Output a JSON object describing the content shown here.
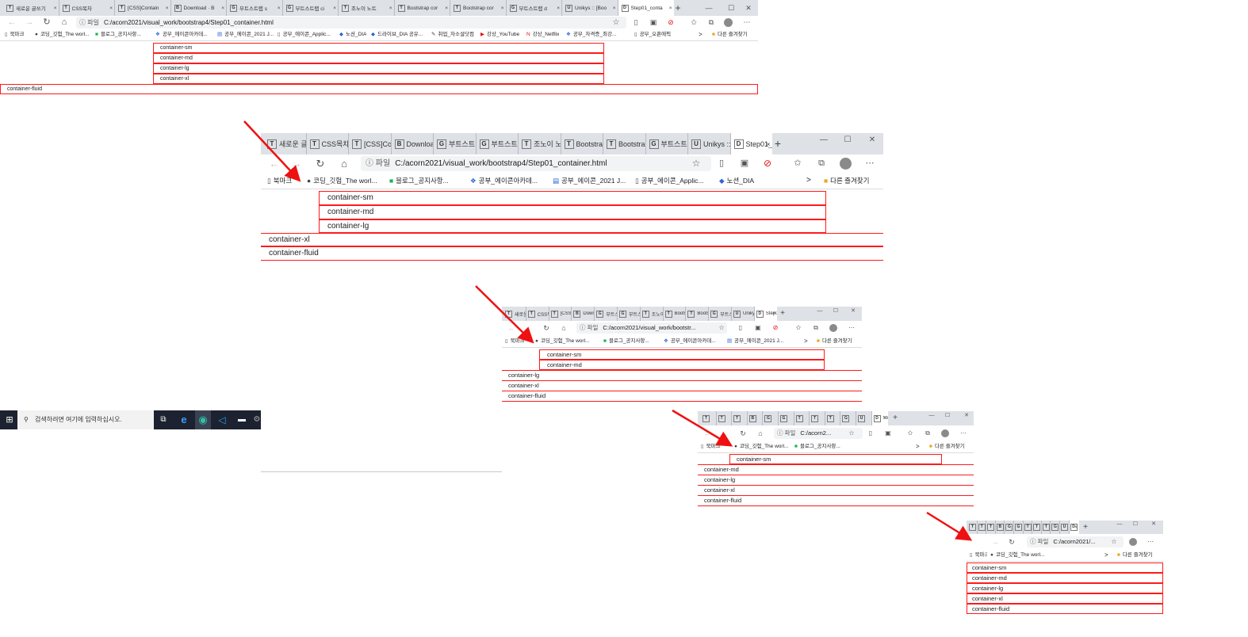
{
  "window": {
    "tabs": [
      {
        "icon": "T",
        "label": "새로운 글쓰기"
      },
      {
        "icon": "T",
        "label": "CSS목차"
      },
      {
        "icon": "T",
        "label": "[CSS]Contain"
      },
      {
        "icon": "B",
        "label": "Download · B"
      },
      {
        "icon": "G",
        "label": "부트스트랩 s"
      },
      {
        "icon": "G",
        "label": "부트스트랩 ci"
      },
      {
        "icon": "T",
        "label": "조노이 노트"
      },
      {
        "icon": "T",
        "label": "Bootstrap cor"
      },
      {
        "icon": "T",
        "label": "Bootstrap cor"
      },
      {
        "icon": "G",
        "label": "부트스트랩 d"
      },
      {
        "icon": "U",
        "label": "Unikys :: [Boo"
      },
      {
        "icon": "D",
        "label": "Step01_conta"
      }
    ],
    "active_tab_index": 11,
    "new_tab_symbol": "+",
    "close_symbol": "×",
    "win_controls": [
      "—",
      "☐",
      "✕"
    ]
  },
  "address": {
    "scheme": "파일",
    "url": "C:/acorn2021/visual_work/bootstrap4/Step01_container.html",
    "url_short_3": "C:/acorn2021/visual_work/bootstr...",
    "url_short_4": "C:/acorn2...",
    "url_short_5": "C:/acorn2021/..."
  },
  "bookmarks": {
    "items": [
      {
        "icon": "doc-icon",
        "label": "북마크"
      },
      {
        "icon": "github-icon",
        "label": "코딩_깃험_The worl..."
      },
      {
        "icon": "chat-icon",
        "label": "블로그_공지사항..."
      },
      {
        "icon": "academy-icon",
        "label": "공부_에이콘아카데..."
      },
      {
        "icon": "doc-blue-icon",
        "label": "공부_에이콘_2021 J..."
      },
      {
        "icon": "doc-icon",
        "label": "공부_에이콘_Applic..."
      },
      {
        "icon": "diamond-icon",
        "label": "노션_DIA"
      },
      {
        "icon": "diamond-icon",
        "label": "드라이브_DIA 공유..."
      },
      {
        "icon": "pen-icon",
        "label": "취업_자소설닷컴"
      },
      {
        "icon": "youtube-icon",
        "label": "강상_YouTube"
      },
      {
        "icon": "netflix-icon",
        "label": "강상_Netflix"
      },
      {
        "icon": "academy-icon",
        "label": "공부_자격증_최강..."
      },
      {
        "icon": "doc-icon",
        "label": "공부_오픈에픽"
      }
    ],
    "more_symbol": ">",
    "other_folder": "다른 즐겨찾기"
  },
  "containers": [
    "container-sm",
    "container-md",
    "container-lg",
    "container-xl",
    "container-fluid"
  ],
  "taskbar": {
    "search_placeholder": "검색하려면 여기에 입력하십시오."
  },
  "colors": {
    "box_border": "#ff1a1a",
    "arrow": "#ee1111",
    "tabbar_bg": "#dee1e6"
  }
}
